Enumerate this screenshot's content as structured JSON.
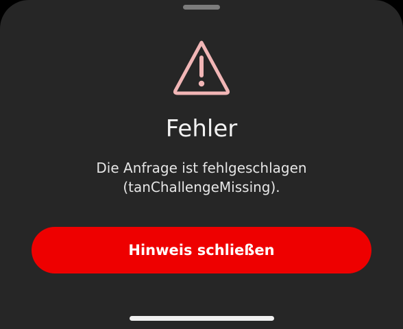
{
  "dialog": {
    "title": "Fehler",
    "message_line1": "Die Anfrage ist fehlgeschlagen",
    "message_line2": "(tanChallengeMissing).",
    "close_label": "Hinweis schließen",
    "icon": "warning-triangle-icon"
  },
  "colors": {
    "sheet_background": "#262626",
    "accent": "#ee0000",
    "warning_icon": "#f1b6b6"
  }
}
